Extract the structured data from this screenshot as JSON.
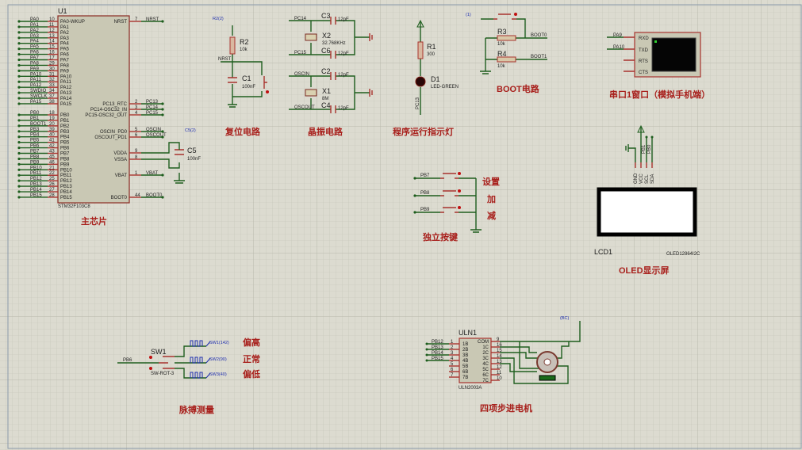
{
  "u1": {
    "ref": "U1",
    "part": "STM32F103C8",
    "left_pins": [
      [
        "PA0",
        "10",
        "PA0-WKUP"
      ],
      [
        "PA1",
        "11",
        "PA1"
      ],
      [
        "PA2",
        "12",
        "PA2"
      ],
      [
        "PA3",
        "13",
        "PA3"
      ],
      [
        "PA4",
        "14",
        "PA4"
      ],
      [
        "PA5",
        "15",
        "PA5"
      ],
      [
        "PA6",
        "16",
        "PA6"
      ],
      [
        "PA7",
        "17",
        "PA7"
      ],
      [
        "PA8",
        "29",
        "PA8"
      ],
      [
        "PA9",
        "30",
        "PA9"
      ],
      [
        "PA10",
        "31",
        "PA10"
      ],
      [
        "PA11",
        "32",
        "PA11"
      ],
      [
        "PA12",
        "33",
        "PA12"
      ],
      [
        "SWDIO",
        "34",
        "PA13"
      ],
      [
        "SWCLK",
        "37",
        "PA14"
      ],
      [
        "PA15",
        "38",
        "PA15"
      ],
      [
        "PB0",
        "18",
        "PB0"
      ],
      [
        "PB1",
        "19",
        "PB1"
      ],
      [
        "BOOT1",
        "20",
        "PB2"
      ],
      [
        "PB3",
        "39",
        "PB3"
      ],
      [
        "PB4",
        "40",
        "PB4"
      ],
      [
        "PB5",
        "41",
        "PB5"
      ],
      [
        "PB6",
        "42",
        "PB6"
      ],
      [
        "PB7",
        "43",
        "PB7"
      ],
      [
        "PB8",
        "45",
        "PB8"
      ],
      [
        "PB9",
        "46",
        "PB9"
      ],
      [
        "PB10",
        "21",
        "PB10"
      ],
      [
        "PB11",
        "22",
        "PB11"
      ],
      [
        "PB12",
        "25",
        "PB12"
      ],
      [
        "PB13",
        "26",
        "PB13"
      ],
      [
        "PB14",
        "27",
        "PB14"
      ],
      [
        "PB15",
        "28",
        "PB15"
      ]
    ],
    "right_pins": [
      [
        "NRST",
        "7",
        "NRST"
      ],
      [
        "PC13",
        "2",
        "PC13_RTC"
      ],
      [
        "PC14",
        "3",
        "PC14-OSC32_IN"
      ],
      [
        "PC15",
        "4",
        "PC15-OSC32_OUT"
      ],
      [
        "OSCIN",
        "5",
        "OSCIN_PD0"
      ],
      [
        "OSCOUT",
        "6",
        "OSCOUT_PD1"
      ],
      [
        "",
        "9",
        "VDDA"
      ],
      [
        "",
        "8",
        "VSSA"
      ],
      [
        "VBAT",
        "1",
        "VBAT"
      ],
      [
        "BOOT0",
        "44",
        "BOOT0"
      ]
    ],
    "title": "主芯片"
  },
  "c5": {
    "ref": "C5",
    "value": "100nF",
    "probe": "C5(2)"
  },
  "reset": {
    "probe": "R2(2)",
    "r_ref": "R2",
    "r_val": "10k",
    "net": "NRST",
    "c_ref": "C1",
    "c_val": "100nF",
    "title": "复位电路"
  },
  "crystal": {
    "pc14": "PC14",
    "pc15": "PC15",
    "c3": "C3",
    "c6": "C6",
    "c2": "C2",
    "c4": "C4",
    "cval": "12pF",
    "x2": "X2",
    "x2val": "32.768KHz",
    "x1": "X1",
    "x1val": "8M",
    "oscin": "OSCIN",
    "oscout": "OSCOUT",
    "title": "晶振电路"
  },
  "led": {
    "r_ref": "R1",
    "r_val": "300",
    "d_ref": "D1",
    "d_val": "LED-GREEN",
    "net": "PC13",
    "title": "程序运行指示灯"
  },
  "boot": {
    "probe": "(1)",
    "r3": "R3",
    "r4": "R4",
    "rval": "10k",
    "boot0": "BOOT0",
    "boot1": "BOOT1",
    "title": "BOOT电路"
  },
  "serial": {
    "pa9": "PA9",
    "pa10": "PA10",
    "pins": [
      "RXD",
      "TXD",
      "RTS",
      "CTS"
    ],
    "title": "串口1窗口（模拟手机端）"
  },
  "oled": {
    "pins": [
      "GND",
      "VCC",
      "SCL",
      "SDA"
    ],
    "nets": [
      "PB1",
      "PB0"
    ],
    "ref": "LCD1",
    "part": "OLED12864I2C",
    "title": "OLED显示屏"
  },
  "keys": {
    "nets": [
      "PB7",
      "PB8",
      "PB9"
    ],
    "labels": [
      "设置",
      "加",
      "减"
    ],
    "title": "独立按键"
  },
  "pulse": {
    "net": "PB6",
    "ref": "SW1",
    "part": "SW-ROT-3",
    "gens": [
      "SW1(142)",
      "SW2(90)",
      "SW3(40)"
    ],
    "labels": [
      "偏高",
      "正常",
      "偏低"
    ],
    "title": "脉搏测量"
  },
  "uln": {
    "ref": "ULN1",
    "part": "ULN2003A",
    "nets": [
      "PB12",
      "PB13",
      "PB14",
      "PB15"
    ],
    "lpins": [
      "1",
      "2",
      "3",
      "4",
      "5",
      "6",
      "7"
    ],
    "lnames": [
      "1B",
      "2B",
      "3B",
      "4B",
      "5B",
      "6B",
      "7B"
    ],
    "rpins": [
      "9",
      "16",
      "15",
      "14",
      "13",
      "12",
      "11",
      "10"
    ],
    "rnames": [
      "COM",
      "1C",
      "2C",
      "3C",
      "4C",
      "5C",
      "6C",
      "7C"
    ],
    "probe": "(BC)",
    "title": "四项步进电机"
  }
}
